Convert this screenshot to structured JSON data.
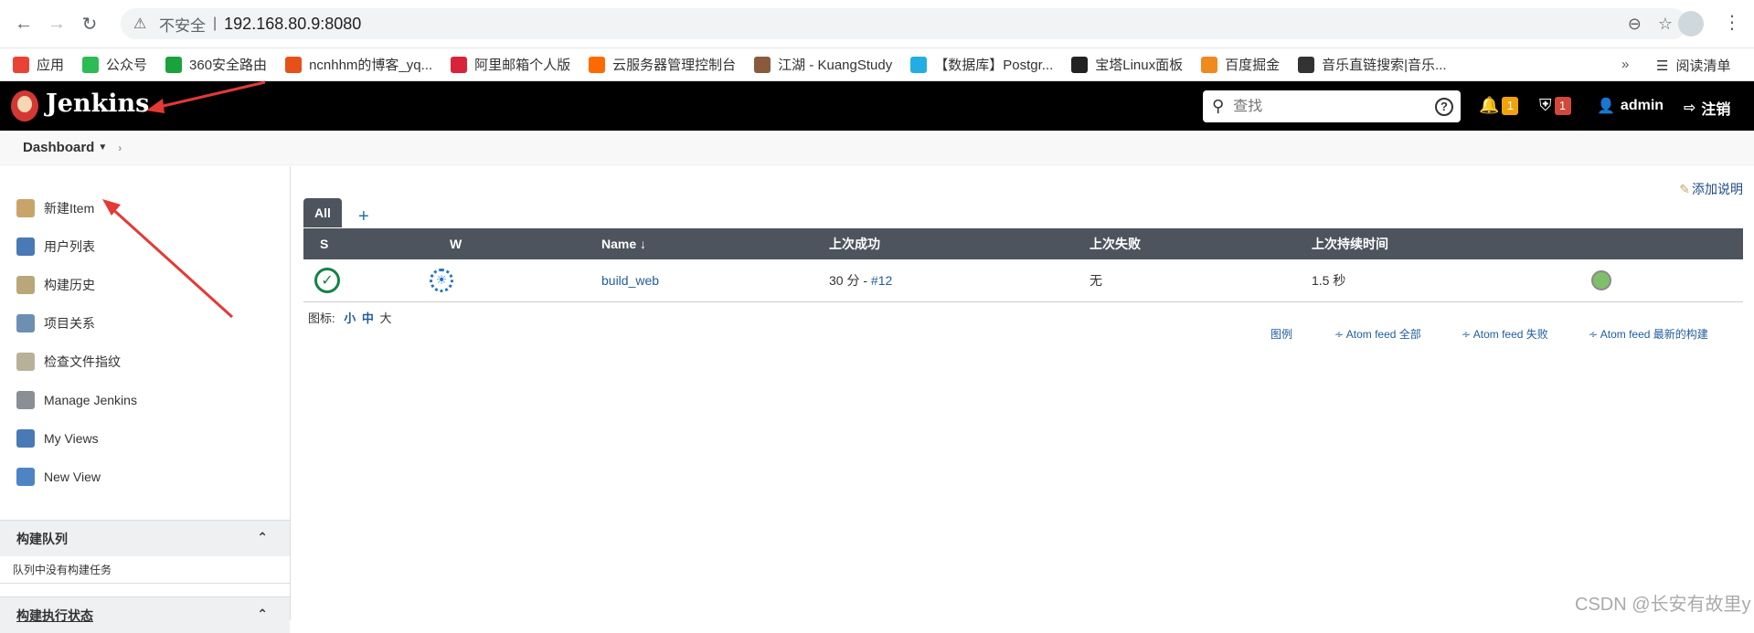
{
  "browser": {
    "insecure_label": "不安全",
    "url": "192.168.80.9:8080",
    "bookmarks": [
      {
        "label": "应用",
        "color": "#ea4335"
      },
      {
        "label": "公众号",
        "color": "#2dbb55"
      },
      {
        "label": "360安全路由",
        "color": "#1aa33c"
      },
      {
        "label": "ncnhhm的博客_yq...",
        "color": "#e8501a"
      },
      {
        "label": "阿里邮箱个人版",
        "color": "#d9233a"
      },
      {
        "label": "云服务器管理控制台",
        "color": "#ff6a00"
      },
      {
        "label": "江湖 - KuangStudy",
        "color": "#8a5a3c"
      },
      {
        "label": "【数据库】Postgr...",
        "color": "#23ade5"
      },
      {
        "label": "宝塔Linux面板",
        "color": "#222222"
      },
      {
        "label": "百度掘金",
        "color": "#f08a1c"
      },
      {
        "label": "音乐直链搜索|音乐...",
        "color": "#333333"
      }
    ],
    "more": "»",
    "reading_list": "阅读清单"
  },
  "header": {
    "title": "Jenkins",
    "search_placeholder": "查找",
    "help": "?",
    "notifications": "1",
    "security_alerts": "1",
    "user": "admin",
    "logout": "注销"
  },
  "breadcrumb": {
    "item": "Dashboard"
  },
  "sidebar": {
    "tasks": [
      {
        "label": "新建Item",
        "color": "#c9a46a"
      },
      {
        "label": "用户列表",
        "color": "#4a7ab5"
      },
      {
        "label": "构建历史",
        "color": "#b9a77a"
      },
      {
        "label": "项目关系",
        "color": "#6d8fb3"
      },
      {
        "label": "检查文件指纹",
        "color": "#b8b098"
      },
      {
        "label": "Manage Jenkins",
        "color": "#8a8f96"
      },
      {
        "label": "My Views",
        "color": "#4a7ab5"
      },
      {
        "label": "New View",
        "color": "#4f84c4"
      }
    ],
    "build_queue": {
      "title": "构建队列",
      "empty": "队列中没有构建任务"
    },
    "executors": {
      "title": "构建执行状态"
    }
  },
  "main": {
    "add_description": "添加说明",
    "tab_all": "All",
    "tab_add": "+",
    "columns": {
      "s": "S",
      "w": "W",
      "name": "Name ↓",
      "last_success": "上次成功",
      "last_failure": "上次失败",
      "last_duration": "上次持续时间"
    },
    "jobs": [
      {
        "name": "build_web",
        "last_success_time": "30 分 - ",
        "last_success_build": "#12",
        "last_failure": "无",
        "last_duration": "1.5 秒"
      }
    ],
    "legend_label": "图标:",
    "icon_sizes": {
      "small": "小",
      "medium": "中",
      "large": "大"
    },
    "feeds": {
      "legend": "图例",
      "all": "Atom feed 全部",
      "failures": "Atom feed 失败",
      "latest": "Atom feed 最新的构建"
    }
  },
  "watermark": "CSDN @长安有故里y"
}
